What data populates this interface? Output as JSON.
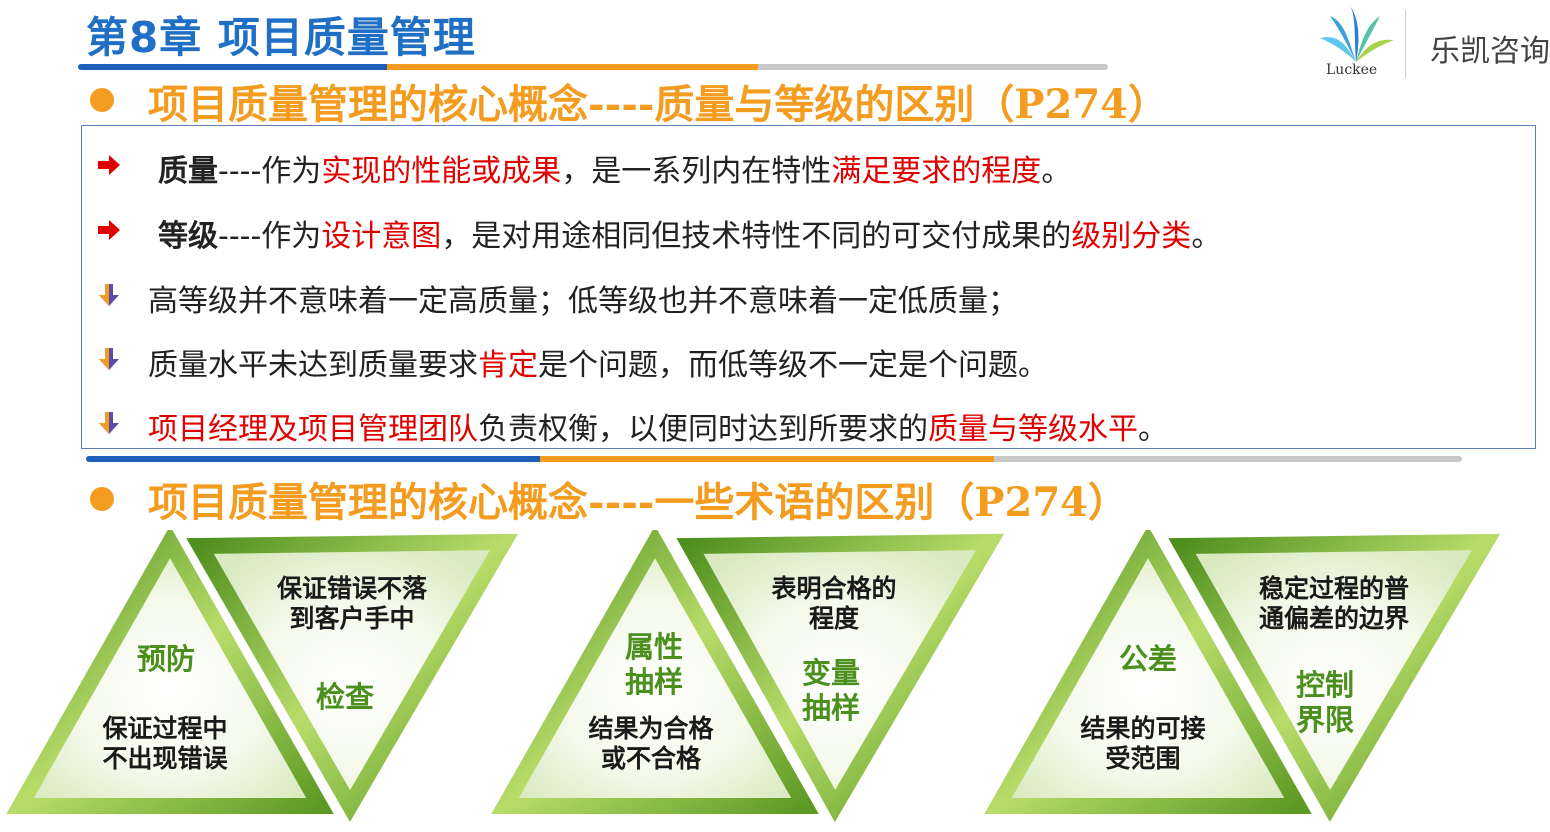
{
  "header": {
    "title": "第8章 项目质量管理"
  },
  "logo": {
    "brand": "Luckee",
    "company": "乐凯咨询"
  },
  "section1": {
    "heading": "项目质量管理的核心概念----质量与等级的区别（P274）"
  },
  "points": [
    {
      "segments": [
        {
          "text": "质量",
          "style": "bold"
        },
        {
          "text": "----作为",
          "style": "normal"
        },
        {
          "text": "实现的性能或成果",
          "style": "red"
        },
        {
          "text": "，是一系列内在特性",
          "style": "normal"
        },
        {
          "text": "满足要求的程度",
          "style": "red"
        },
        {
          "text": "。",
          "style": "normal"
        }
      ]
    },
    {
      "segments": [
        {
          "text": "等级",
          "style": "bold"
        },
        {
          "text": "----作为",
          "style": "normal"
        },
        {
          "text": "设计意图",
          "style": "red"
        },
        {
          "text": "，是对用途相同但技术特性不同的可交付成果的",
          "style": "normal"
        },
        {
          "text": "级别分类",
          "style": "red"
        },
        {
          "text": "。",
          "style": "normal"
        }
      ]
    },
    {
      "segments": [
        {
          "text": "高等级并不意味着一定高质量；低等级也并不意味着一定低质量；",
          "style": "normal"
        }
      ]
    },
    {
      "segments": [
        {
          "text": "质量水平未达到质量要求",
          "style": "normal"
        },
        {
          "text": "肯定",
          "style": "red"
        },
        {
          "text": "是个问题，而低等级不一定是个问题。",
          "style": "normal"
        }
      ]
    },
    {
      "segments": [
        {
          "text": "项目经理及项目管理团队",
          "style": "red"
        },
        {
          "text": "负责权衡，以便同时达到所要求的",
          "style": "normal"
        },
        {
          "text": "质量与等级水平",
          "style": "red"
        },
        {
          "text": "。",
          "style": "normal"
        }
      ]
    }
  ],
  "section2": {
    "heading": "项目质量管理的核心概念----一些术语的区别（P274）"
  },
  "triangles": {
    "pair1": {
      "up_term": "预防",
      "up_desc": "保证过程中\n不出现错误",
      "down_desc": "保证错误不落\n到客户手中",
      "down_term": "检查"
    },
    "pair2": {
      "up_term": "属性\n抽样",
      "up_desc": "结果为合格\n或不合格",
      "down_desc": "表明合格的\n程度",
      "down_term": "变量\n抽样"
    },
    "pair3": {
      "up_term": "公差",
      "up_desc": "结果的可接\n受范围",
      "down_desc": "稳定过程的普\n通偏差的边界",
      "down_term": "控制\n界限"
    }
  },
  "colors": {
    "title_blue": "#1f6fc5",
    "heading_orange": "#f39c1f",
    "emphasis_red": "#e00000",
    "triangle_green": "#6aa32a"
  }
}
